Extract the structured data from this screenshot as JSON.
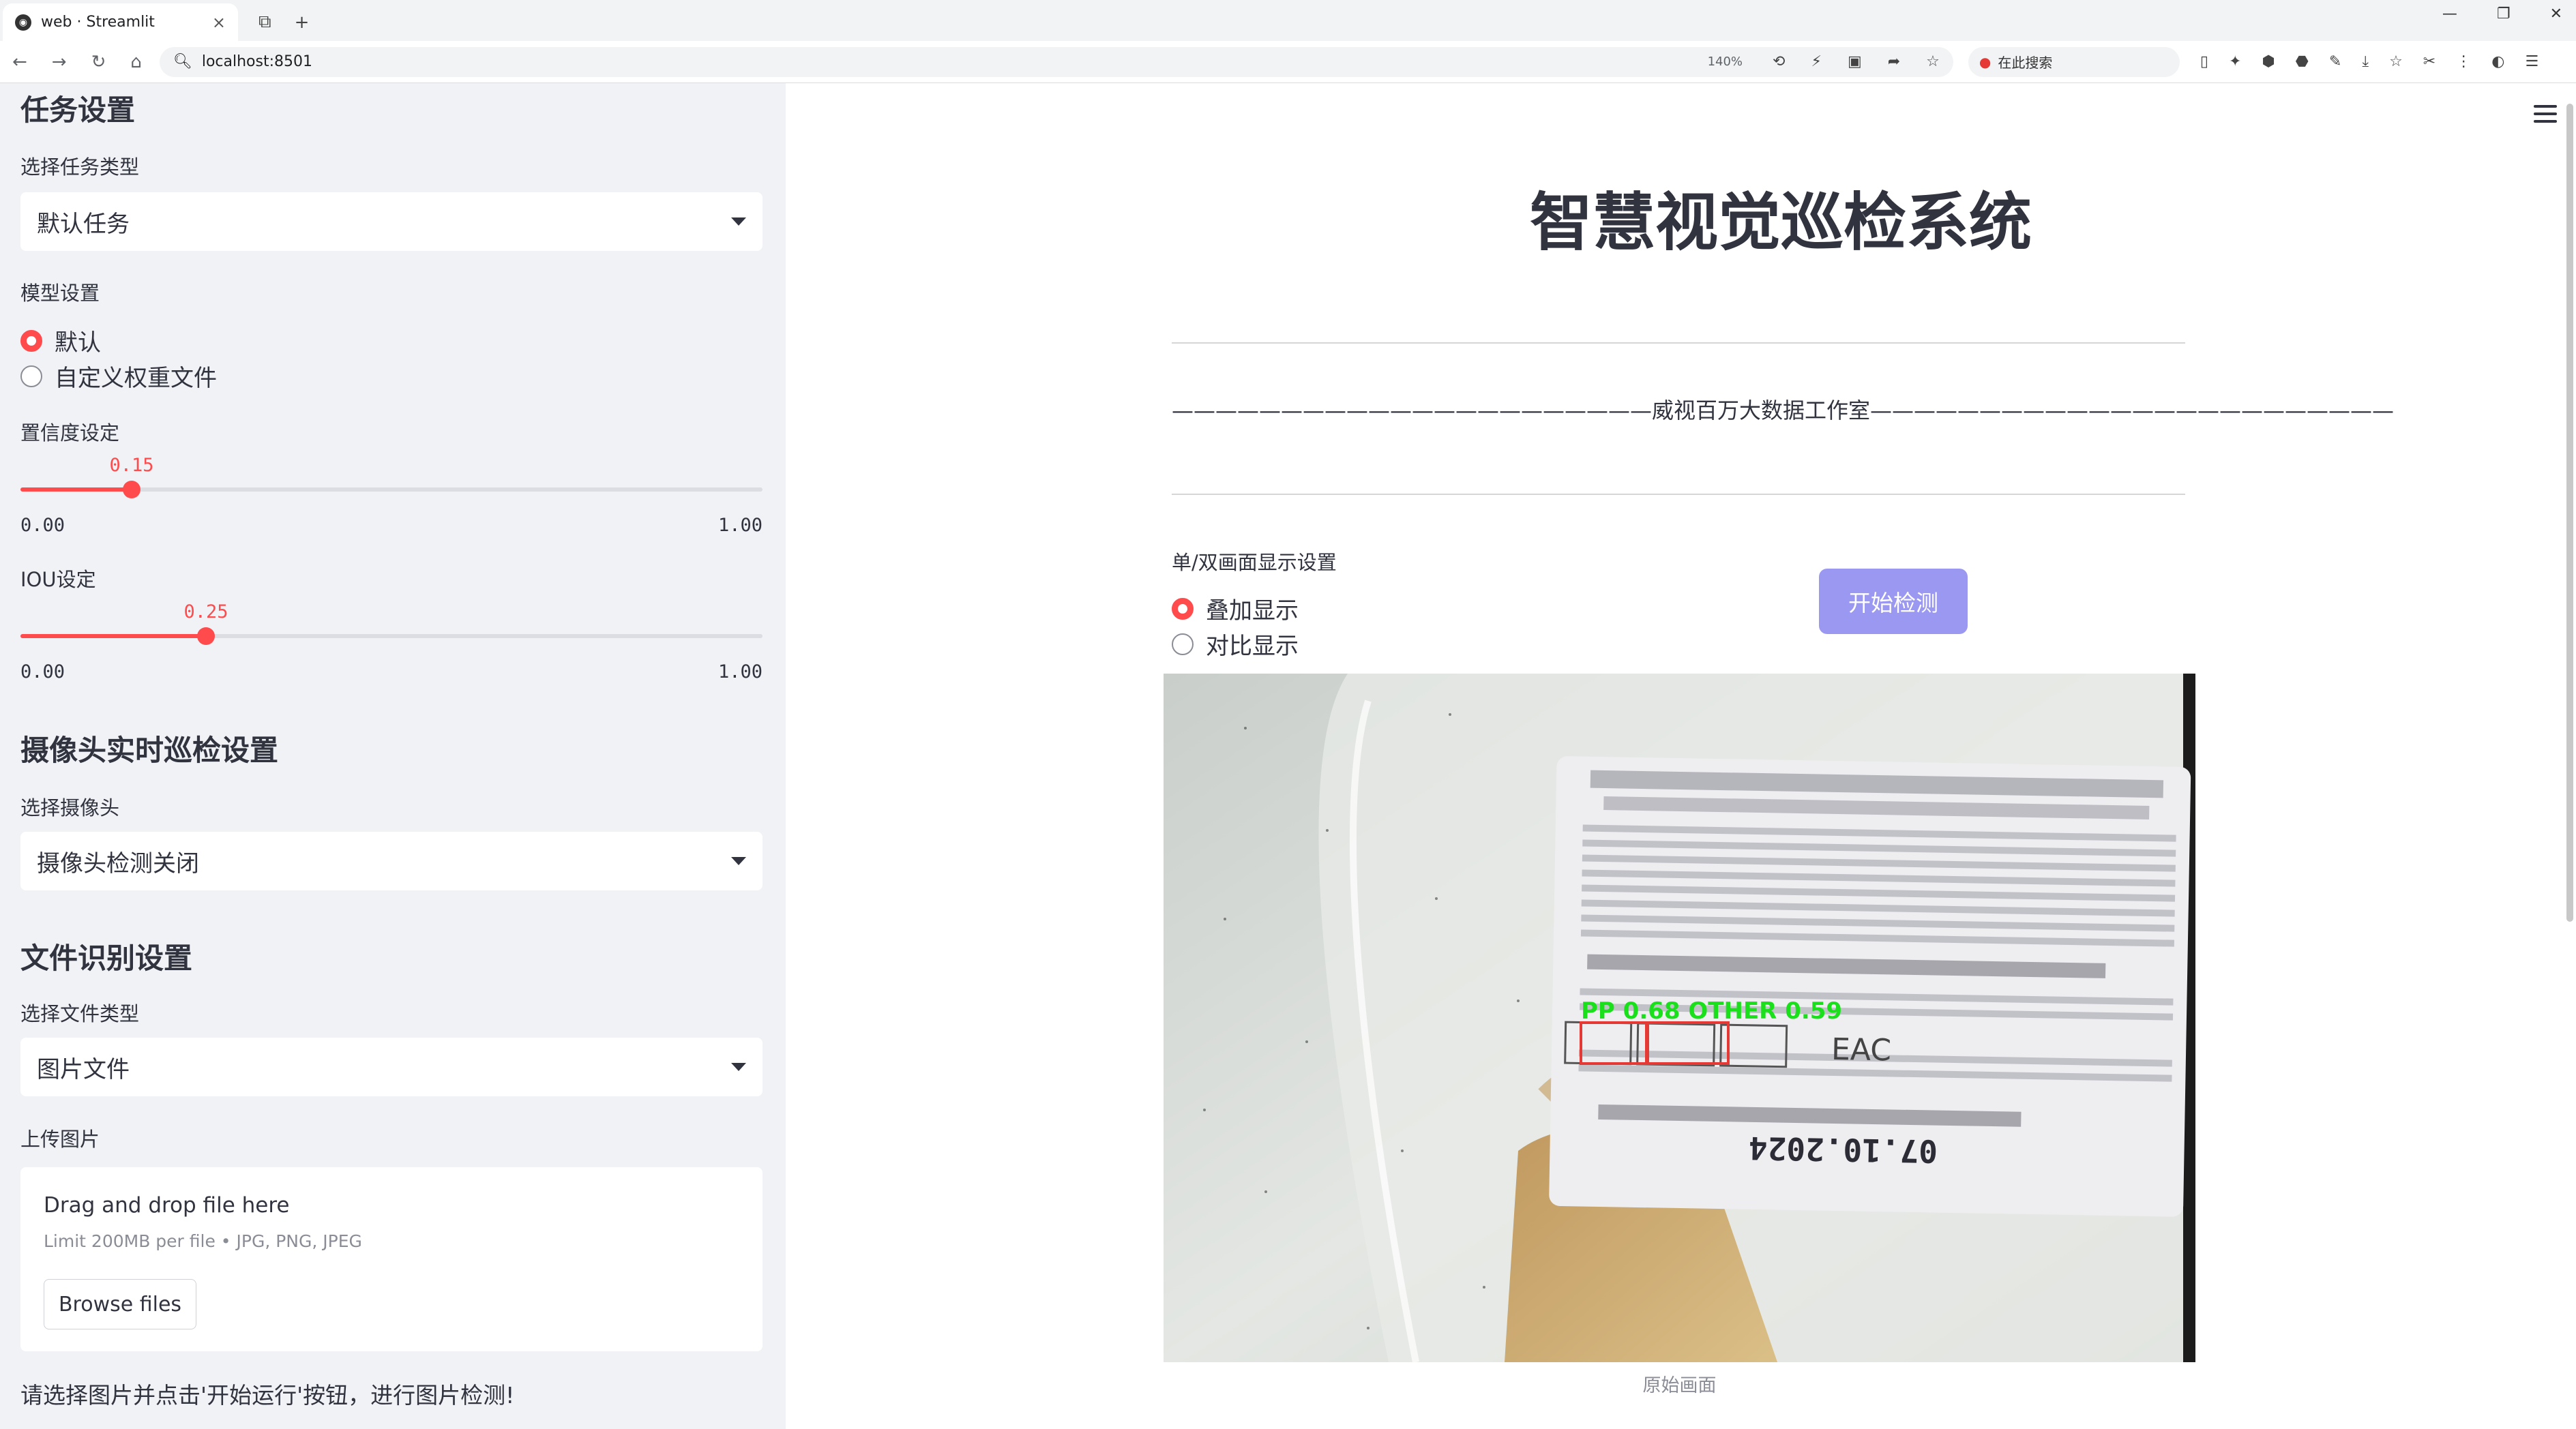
{
  "browser": {
    "tab_title": "web · Streamlit",
    "url": "localhost:8501",
    "zoom": "140%",
    "search_placeholder": "在此搜索"
  },
  "sidebar": {
    "task_section": "任务设置",
    "task_type_label": "选择任务类型",
    "task_type_value": "默认任务",
    "model_label": "模型设置",
    "model_options": [
      "默认",
      "自定义权重文件"
    ],
    "model_selected": 0,
    "conf_label": "置信度设定",
    "conf": {
      "value": "0.15",
      "min": "0.00",
      "max": "1.00",
      "fraction": 0.15
    },
    "iou_label": "IOU设定",
    "iou": {
      "value": "0.25",
      "min": "0.00",
      "max": "1.00",
      "fraction": 0.25
    },
    "camera_section": "摄像头实时巡检设置",
    "camera_label": "选择摄像头",
    "camera_value": "摄像头检测关闭",
    "file_section": "文件识别设置",
    "file_type_label": "选择文件类型",
    "file_type_value": "图片文件",
    "upload_label": "上传图片",
    "upload_drag": "Drag and drop file here",
    "upload_limit": "Limit 200MB per file • JPG, PNG, JPEG",
    "browse_button": "Browse files",
    "hint": "请选择图片并点击'开始运行'按钮，进行图片检测!"
  },
  "main": {
    "title": "智慧视觉巡检系统",
    "subtitle": "——————————————————————威视百万大数据工作室————————————————————————",
    "display_label": "单/双画面显示设置",
    "display_options": [
      "叠加显示",
      "对比显示"
    ],
    "display_selected": 0,
    "start_button": "开始检测",
    "caption": "原始画面",
    "detection_text": "PP 0.68 OTHER 0.59",
    "label_date": "07.10.2024"
  },
  "colors": {
    "accent": "#ff4b4b",
    "button": "#9b98f2",
    "sidebar_bg": "#f0f2f6",
    "detect_box": "#e53935",
    "detect_text": "#19e01a"
  }
}
